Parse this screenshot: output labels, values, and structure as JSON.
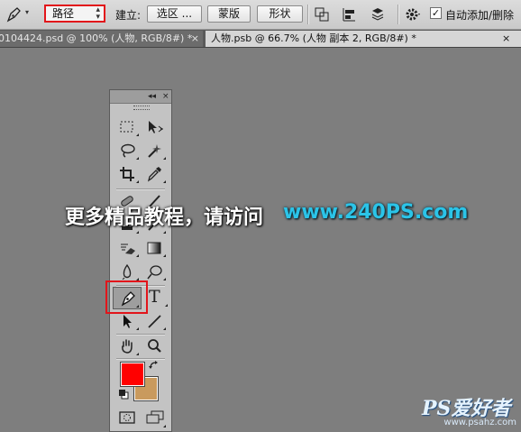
{
  "options_bar": {
    "mode_value": "路径",
    "make_label": "建立:",
    "selection_button": "选区 ...",
    "mask_button": "蒙版",
    "shape_button": "形状",
    "auto_add_delete_checked": true,
    "auto_add_delete_label": "自动添加/删除"
  },
  "tabs": [
    {
      "label": "0104424.psd @ 100% (人物, RGB/8#) *",
      "close": "×",
      "active": false
    },
    {
      "label": "人物.psb @ 66.7% (人物 副本 2, RGB/8#) *",
      "close": "×",
      "active": true
    }
  ],
  "tools_panel": {
    "collapse_glyph": "◂◂",
    "close_glyph": "×",
    "type_tool_glyph": "T",
    "selected_tool": "pen-tool",
    "foreground_color": "#ff0000",
    "background_color": "#c99a5e"
  },
  "overlay": {
    "caption": "更多精品教程，请访问",
    "url": "www.240PS.com"
  },
  "logo": {
    "brand": "PS爱好者",
    "site": "www.psahz.com"
  }
}
